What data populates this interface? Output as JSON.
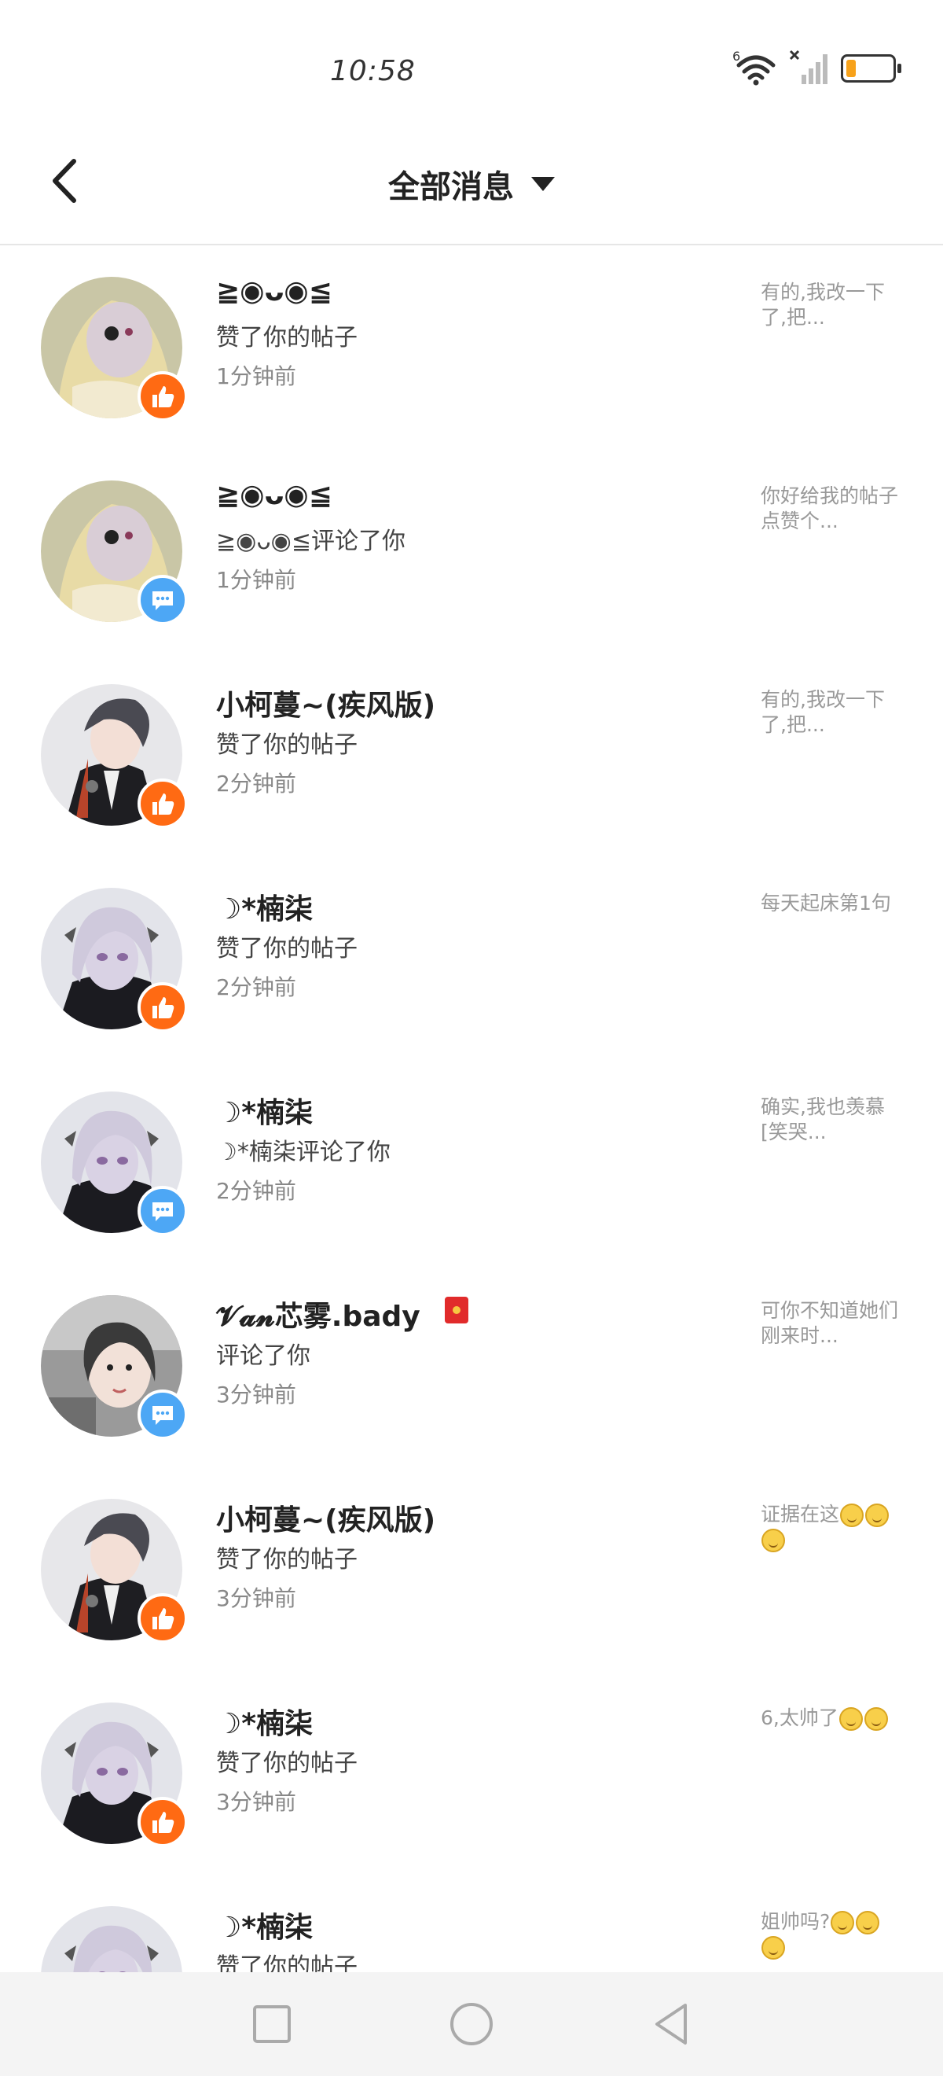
{
  "status_bar": {
    "time": "10:58",
    "wifi_label": "6",
    "battery_color": "#f7a21b"
  },
  "header": {
    "back_icon": "chevron-left-icon",
    "title": "全部消息",
    "title_dropdown_icon": "caret-down-icon"
  },
  "messages": [
    {
      "name": "≧◉ᴗ◉≦",
      "action": "赞了你的帖子",
      "time": "1分钟前",
      "preview": "有的,我改一下了,把...",
      "badge": "like",
      "avatar": "yellow-hood"
    },
    {
      "name": "≧◉ᴗ◉≦",
      "action": "≧◉ᴗ◉≦评论了你",
      "time": "1分钟前",
      "preview": "你好给我的帖子点赞个...",
      "badge": "comment",
      "avatar": "yellow-hood"
    },
    {
      "name": "小柯蔓~(疾风版)",
      "action": "赞了你的帖子",
      "time": "2分钟前",
      "preview": "有的,我改一下了,把...",
      "badge": "like",
      "avatar": "dark-suit"
    },
    {
      "name": "☽*楠柒",
      "action": "赞了你的帖子",
      "time": "2分钟前",
      "preview": "每天起床第1句",
      "badge": "like",
      "avatar": "silver-hair"
    },
    {
      "name": "☽*楠柒",
      "action": "☽*楠柒评论了你",
      "time": "2分钟前",
      "preview": "确实,我也羡慕[笑哭...",
      "badge": "comment",
      "avatar": "silver-hair"
    },
    {
      "name": "𝓥𝓪𝓷芯雾.bady",
      "action": "评论了你",
      "time": "3分钟前",
      "preview": "可你不知道她们刚来时...",
      "badge": "comment",
      "avatar": "photo"
    },
    {
      "name": "小柯蔓~(疾风版)",
      "action": "赞了你的帖子",
      "time": "3分钟前",
      "preview": "证据在这",
      "badge": "like",
      "avatar": "dark-suit"
    },
    {
      "name": "☽*楠柒",
      "action": "赞了你的帖子",
      "time": "3分钟前",
      "preview": "6,太帅了",
      "badge": "like",
      "avatar": "silver-hair"
    },
    {
      "name": "☽*楠柒",
      "action": "赞了你的帖子",
      "time": "",
      "preview": "姐帅吗?",
      "badge": "like",
      "avatar": "silver-hair"
    }
  ],
  "bottom_nav": {
    "recent_icon": "square-icon",
    "home_icon": "circle-icon",
    "back_icon": "triangle-back-icon"
  }
}
